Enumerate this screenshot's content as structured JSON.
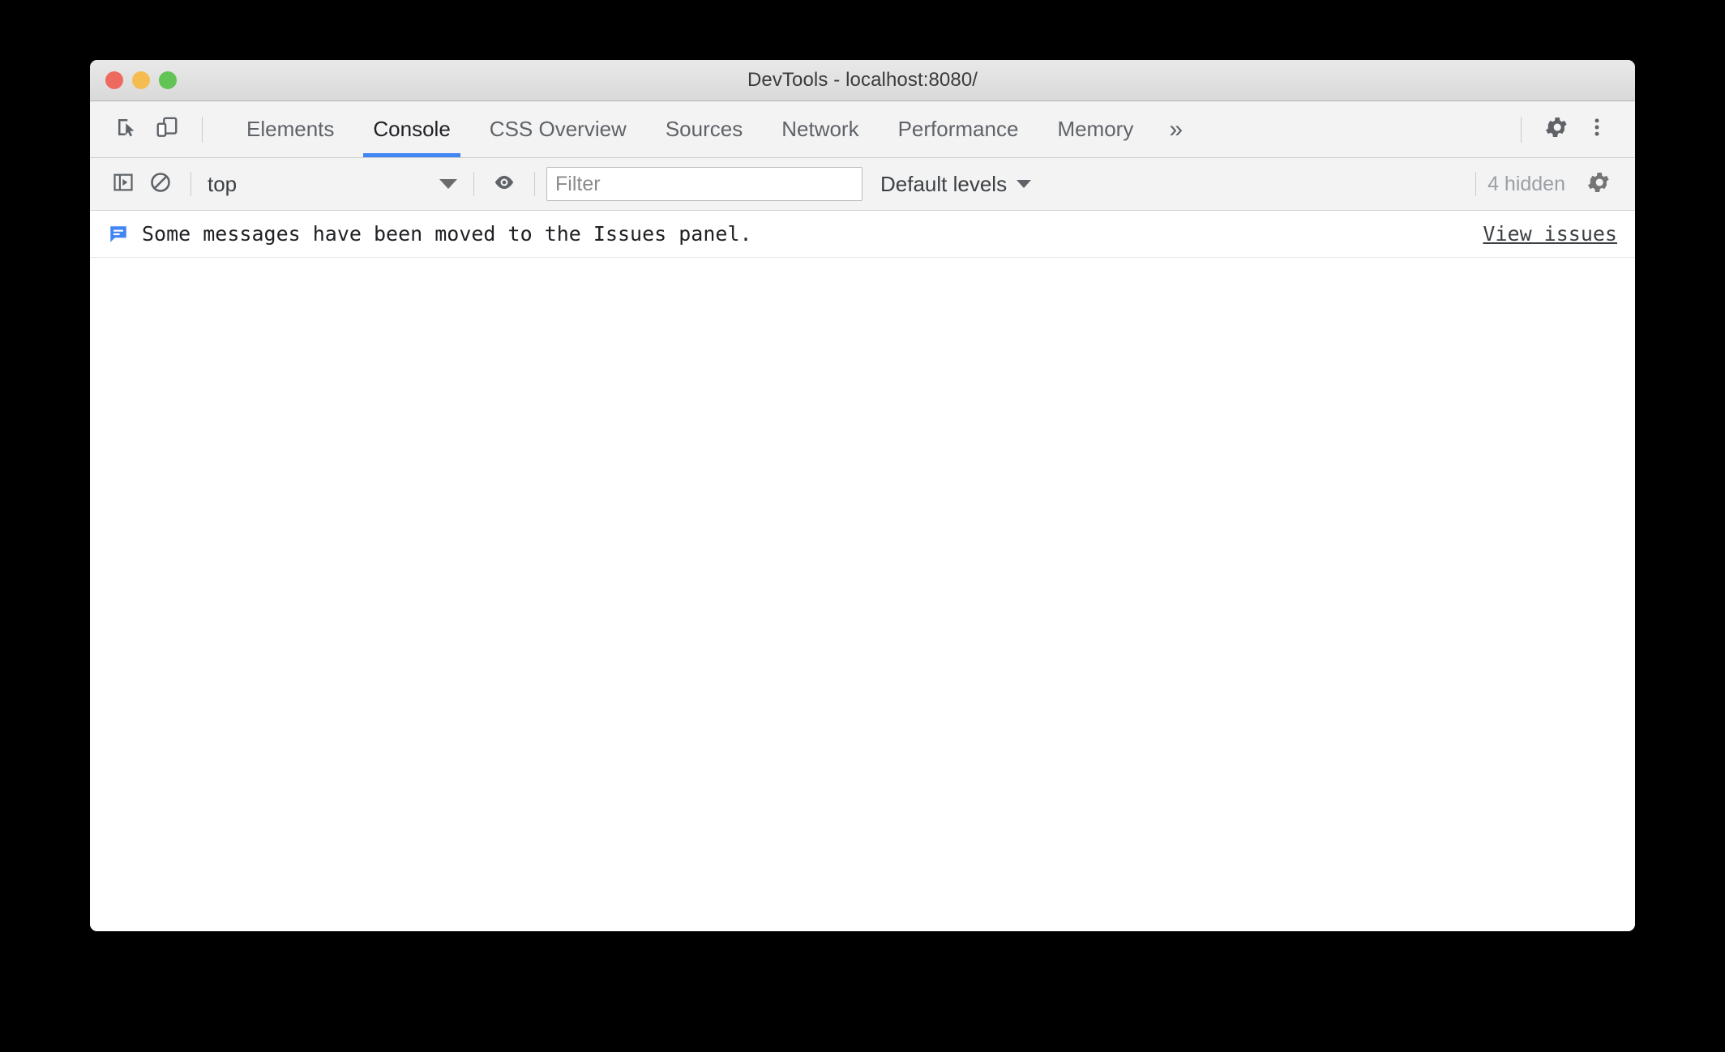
{
  "window": {
    "title": "DevTools - localhost:8080/",
    "traffic_lights": [
      {
        "name": "close",
        "color": "#ee6a5f"
      },
      {
        "name": "minimize",
        "color": "#f5bd4f"
      },
      {
        "name": "maximize",
        "color": "#61c454"
      }
    ]
  },
  "tabbar": {
    "left_icons": [
      {
        "name": "inspect-element-icon",
        "label": "Inspect element"
      },
      {
        "name": "device-toolbar-icon",
        "label": "Toggle device toolbar"
      }
    ],
    "tabs": [
      {
        "label": "Elements",
        "active": false
      },
      {
        "label": "Console",
        "active": true
      },
      {
        "label": "CSS Overview",
        "active": false
      },
      {
        "label": "Sources",
        "active": false
      },
      {
        "label": "Network",
        "active": false
      },
      {
        "label": "Performance",
        "active": false
      },
      {
        "label": "Memory",
        "active": false
      }
    ],
    "more_tabs_label": "»",
    "right_icons": [
      {
        "name": "settings-gear-icon",
        "label": "Settings"
      },
      {
        "name": "more-options-icon",
        "label": "Customize and control DevTools"
      }
    ],
    "active_tab_color": "#4285f4"
  },
  "console_toolbar": {
    "sidebar_toggle": {
      "name": "console-sidebar-icon",
      "label": "Show console sidebar"
    },
    "clear_console": {
      "name": "clear-console-icon",
      "label": "Clear console"
    },
    "context": {
      "value": "top",
      "label": "JavaScript context"
    },
    "live_expression": {
      "name": "eye-icon",
      "label": "Create live expression"
    },
    "filter": {
      "value": "",
      "placeholder": "Filter"
    },
    "levels": {
      "value": "Default levels"
    },
    "hidden_count": "4 hidden",
    "settings": {
      "name": "console-settings-gear-icon",
      "label": "Console settings"
    }
  },
  "console_messages": [
    {
      "icon": "info-message-icon",
      "icon_color": "#4285f4",
      "text": "Some messages have been moved to the Issues panel.",
      "link": "View issues"
    }
  ]
}
